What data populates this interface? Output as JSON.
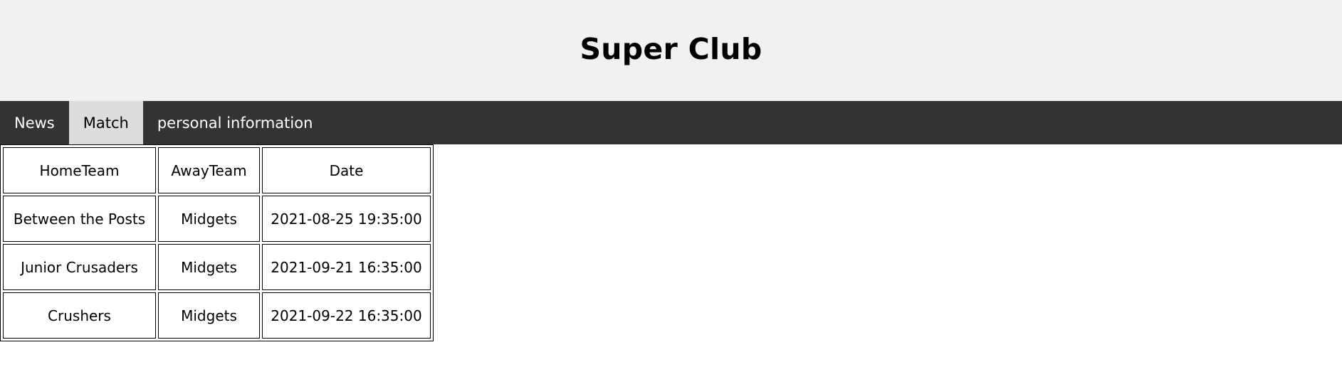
{
  "header": {
    "title": "Super Club"
  },
  "nav": {
    "items": [
      {
        "label": "News",
        "active": false
      },
      {
        "label": "Match",
        "active": true
      },
      {
        "label": "personal information",
        "active": false
      }
    ]
  },
  "matches": {
    "columns": [
      "HomeTeam",
      "AwayTeam",
      "Date"
    ],
    "rows": [
      [
        "Between the Posts",
        "Midgets",
        "2021-08-25 19:35:00"
      ],
      [
        "Junior Crusaders",
        "Midgets",
        "2021-09-21 16:35:00"
      ],
      [
        "Crushers",
        "Midgets",
        "2021-09-22 16:35:00"
      ]
    ]
  },
  "colors": {
    "header_bg": "#f1f1f1",
    "nav_bg": "#333333",
    "nav_active_bg": "#dddddd",
    "nav_text": "#ffffff"
  }
}
